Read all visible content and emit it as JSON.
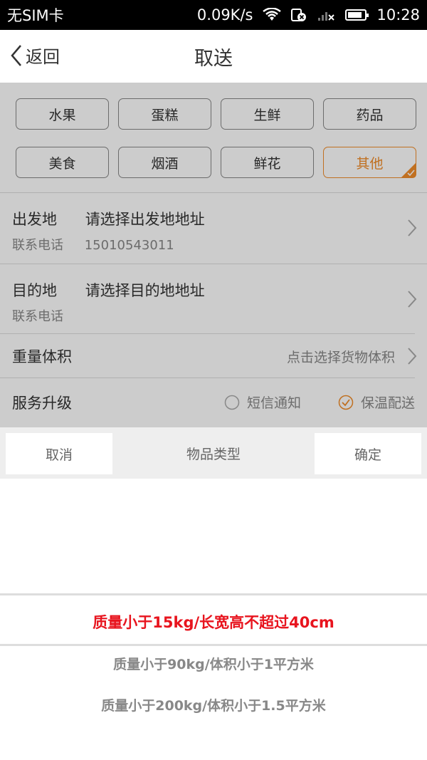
{
  "status_bar": {
    "carrier": "无SIM卡",
    "speed": "0.09K/s",
    "time": "10:28",
    "battery_level": 0.85
  },
  "nav": {
    "back_label": "返回",
    "title": "取送"
  },
  "categories": [
    {
      "label": "水果",
      "selected": false
    },
    {
      "label": "蛋糕",
      "selected": false
    },
    {
      "label": "生鲜",
      "selected": false
    },
    {
      "label": "药品",
      "selected": false
    },
    {
      "label": "美食",
      "selected": false
    },
    {
      "label": "烟酒",
      "selected": false
    },
    {
      "label": "鲜花",
      "selected": false
    },
    {
      "label": "其他",
      "selected": true
    }
  ],
  "origin": {
    "label": "出发地",
    "placeholder": "请选择出发地地址",
    "phone_label": "联系电话",
    "phone": "15010543011"
  },
  "destination": {
    "label": "目的地",
    "placeholder": "请选择目的地地址",
    "phone_label": "联系电话"
  },
  "weight": {
    "label": "重量体积",
    "hint": "点击选择货物体积"
  },
  "service": {
    "label": "服务升级",
    "options": [
      {
        "label": "短信通知",
        "checked": false
      },
      {
        "label": "保温配送",
        "checked": true
      }
    ]
  },
  "picker": {
    "cancel_label": "取消",
    "title": "物品类型",
    "confirm_label": "确定",
    "options": [
      {
        "label": "质量小于15kg/长宽高不超过40cm",
        "selected": true
      },
      {
        "label": "质量小于90kg/体积小于1平方米",
        "selected": false
      },
      {
        "label": "质量小于200kg/体积小于1.5平方米",
        "selected": false
      }
    ]
  },
  "colors": {
    "accent": "#f08c2a",
    "selected_text": "#e8141e"
  }
}
